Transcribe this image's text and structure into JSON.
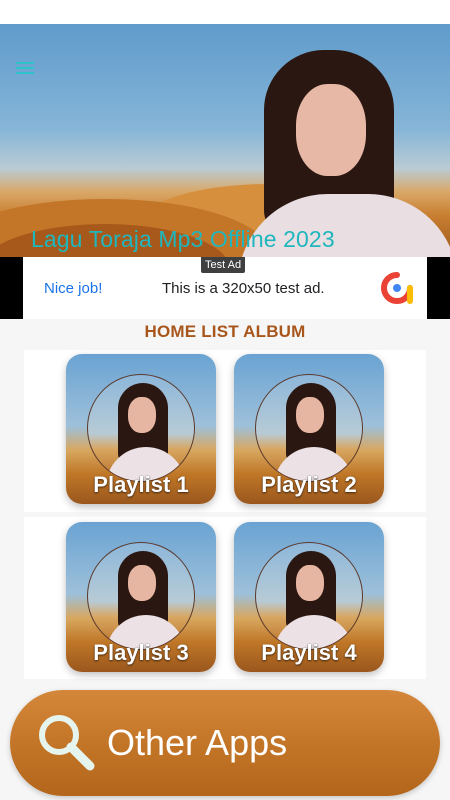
{
  "header": {
    "title": "Lagu Toraja Mp3 Offline 2023",
    "menu_icon": "hamburger-menu-icon",
    "title_color": "#1fb7bd"
  },
  "ad": {
    "tag": "Test Ad",
    "nice": "Nice job!",
    "text": "This is a 320x50 test ad.",
    "logo_icon": "admob-logo-icon"
  },
  "section": {
    "title": "HOME LIST ALBUM",
    "title_color": "#a8561c"
  },
  "playlists": [
    {
      "label": "Playlist 1"
    },
    {
      "label": "Playlist 2"
    },
    {
      "label": "Playlist 3"
    },
    {
      "label": "Playlist 4"
    }
  ],
  "other_apps": {
    "label": "Other Apps",
    "icon": "search-icon",
    "color": "#c27426"
  }
}
